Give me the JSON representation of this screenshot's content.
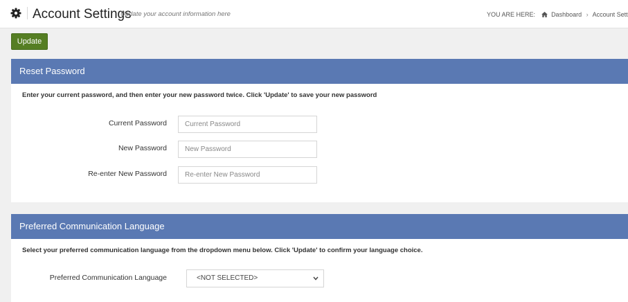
{
  "header": {
    "title": "Account Settings",
    "subtitle": "Update your account information here",
    "breadcrumb": {
      "prefix": "YOU ARE HERE:",
      "items": [
        "Dashboard",
        "Account Settings"
      ]
    }
  },
  "toolbar": {
    "update_label": "Update"
  },
  "reset_password": {
    "heading": "Reset Password",
    "description": "Enter your current password, and then enter your new password twice. Click 'Update' to save your new password",
    "fields": [
      {
        "label": "Current Password",
        "placeholder": "Current Password",
        "value": ""
      },
      {
        "label": "New Password",
        "placeholder": "New Password",
        "value": ""
      },
      {
        "label": "Re-enter New Password",
        "placeholder": "Re-enter New Password",
        "value": ""
      }
    ]
  },
  "language": {
    "heading": "Preferred Communication Language",
    "description": "Select your preferred communication language from the dropdown menu below. Click 'Update' to confirm your language choice.",
    "label": "Preferred Communication Language",
    "selected": "<NOT SELECTED>"
  },
  "colors": {
    "panel_heading": "#5a79b3",
    "update_button": "#557e23",
    "background": "#f0f0f0"
  },
  "icons": [
    "gear-icon",
    "home-icon",
    "chevron-down-icon"
  ]
}
